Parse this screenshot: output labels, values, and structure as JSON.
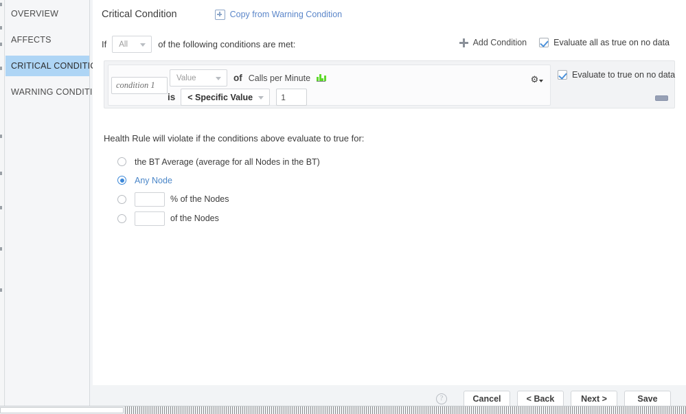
{
  "sidebar": {
    "items": [
      {
        "id": "overview",
        "label": "OVERVIEW",
        "selected": false
      },
      {
        "id": "affects",
        "label": "AFFECTS",
        "selected": false
      },
      {
        "id": "critical",
        "label": "CRITICAL CONDITION",
        "selected": true
      },
      {
        "id": "warning",
        "label": "WARNING CONDITION",
        "selected": false
      }
    ]
  },
  "header": {
    "title": "Critical Condition",
    "copy_link_label": "Copy from Warning Condition",
    "copy_icon": "copy-plus-icon",
    "link_color": "#5b86c9"
  },
  "if_row": {
    "prefix": "If",
    "match_select_value": "All",
    "suffix": "of the following conditions are met:",
    "add_condition_label": "Add Condition",
    "add_condition_icon": "plus-icon",
    "evaluate_all_label": "Evaluate all as true on no data",
    "evaluate_all_checked": true
  },
  "condition": {
    "name_placeholder": "condition 1",
    "name_value": "",
    "value_select": "Value",
    "of_label": "of",
    "metric_label": "Calls per Minute",
    "metric_icon": "bar-chart-icon",
    "is_label": "is",
    "operator_select": "< Specific Value",
    "threshold_value": "1",
    "gear_icon": "gear-dropdown-icon",
    "evaluate_true_label": "Evaluate to true on no data",
    "evaluate_true_checked": true,
    "remove_icon": "minus-icon"
  },
  "violate": {
    "label": "Health Rule will violate if the conditions above evaluate to true for:",
    "options": [
      {
        "id": "bt-average",
        "label": "the BT Average (average for all Nodes in the BT)",
        "selected": false,
        "input": false,
        "input_value": ""
      },
      {
        "id": "any-node",
        "label": "Any Node",
        "selected": true,
        "input": false,
        "input_value": ""
      },
      {
        "id": "pct-nodes",
        "label": "% of the Nodes",
        "selected": false,
        "input": true,
        "input_value": ""
      },
      {
        "id": "num-nodes",
        "label": "of the Nodes",
        "selected": false,
        "input": true,
        "input_value": ""
      }
    ]
  },
  "footer": {
    "help_icon": "question-mark-icon",
    "help_glyph": "?",
    "buttons": [
      {
        "id": "cancel",
        "label": "Cancel"
      },
      {
        "id": "back",
        "label": "< Back"
      },
      {
        "id": "next",
        "label": "Next >"
      },
      {
        "id": "save",
        "label": "Save"
      }
    ]
  },
  "colors": {
    "selected_nav": "#aed5f5",
    "accent_blue": "#3b87d8",
    "metric_green": "#5fd92b",
    "page_bg": "#f2f4f6"
  }
}
